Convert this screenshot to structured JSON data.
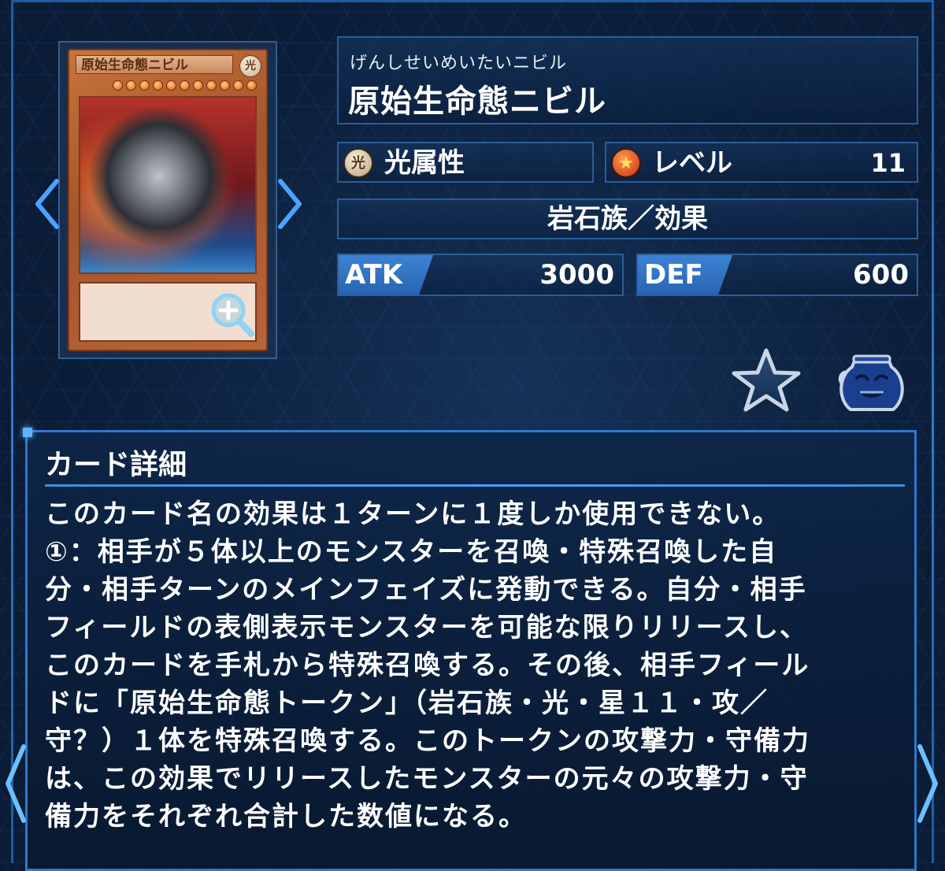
{
  "card": {
    "name_ruby": "げんしせいめいたいニビル",
    "name": "原始生命態ニビル",
    "image_name_text": "原始生命態ニビル",
    "image_attribute_glyph": "光",
    "attribute_icon_glyph": "光",
    "attribute": "光属性",
    "level_label": "レベル",
    "level": "11",
    "type": "岩石族／効果",
    "atk_label": "ATK",
    "atk": "3000",
    "def_label": "DEF",
    "def": "600"
  },
  "details": {
    "title": "カード詳細",
    "lines": [
      "このカード名の効果は１ターンに１度しか使用できない。",
      "①：相手が５体以上のモンスターを召喚・特殊召喚した自",
      "分・相手ターンのメインフェイズに発動できる。自分・相手",
      "フィールドの表側表示モンスターを可能な限りリリースし、",
      "このカードを手札から特殊召喚する。その後、相手フィール",
      "ドに「原始生命態トークン」（岩石族・光・星１１・攻／",
      "守？）１体を特殊召喚する。このトークンの攻撃力・守備力",
      "は、この効果でリリースしたモンスターの元々の攻撃力・守",
      "備力をそれぞれ合計した数値になる。"
    ]
  },
  "icons": {
    "zoom": "zoom-in-icon",
    "favorite": "star-icon",
    "deck_pot": "pot-of-greed-icon",
    "prev": "chevron-left-icon",
    "next": "chevron-right-icon"
  },
  "colors": {
    "background": "#0a1c36",
    "panel_border": "#2b5e99",
    "stat_tag": "#3d82d3",
    "detail_border": "#2e79c9"
  }
}
